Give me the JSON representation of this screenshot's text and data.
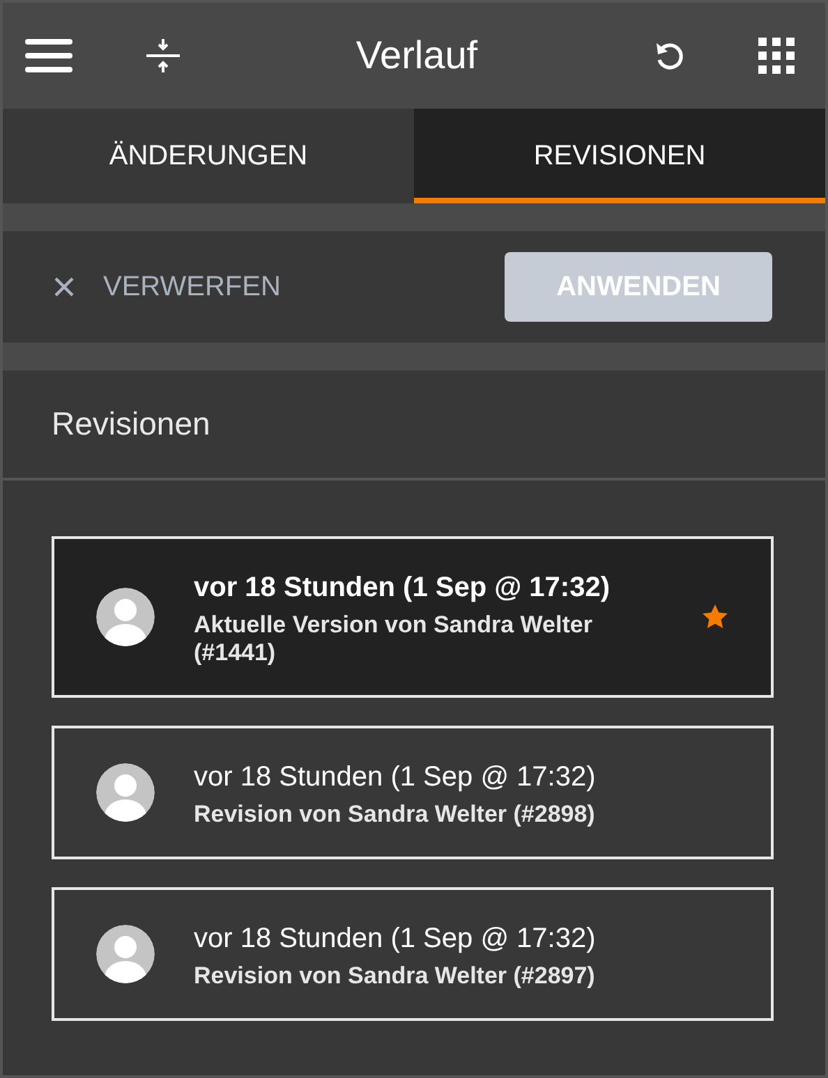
{
  "header": {
    "title": "Verlauf"
  },
  "tabs": [
    {
      "label": "ÄNDERUNGEN",
      "selected": false
    },
    {
      "label": "REVISIONEN",
      "selected": true
    }
  ],
  "actions": {
    "discard": "VERWERFEN",
    "apply": {
      "label": "ANWENDEN",
      "disabled": true
    }
  },
  "section": {
    "title": "Revisionen"
  },
  "revisions": [
    {
      "date": "vor 18 Stunden (1 Sep @ 17:32)",
      "description": "Aktuelle Version von Sandra Welter (#1441)",
      "selected": true
    },
    {
      "date": "vor 18 Stunden (1 Sep @ 17:32)",
      "description": "Revision von Sandra Welter (#2898)",
      "selected": false
    },
    {
      "date": "vor 18 Stunden (1 Sep @ 17:32)",
      "description": "Revision von Sandra Welter (#2897)",
      "selected": false
    }
  ]
}
